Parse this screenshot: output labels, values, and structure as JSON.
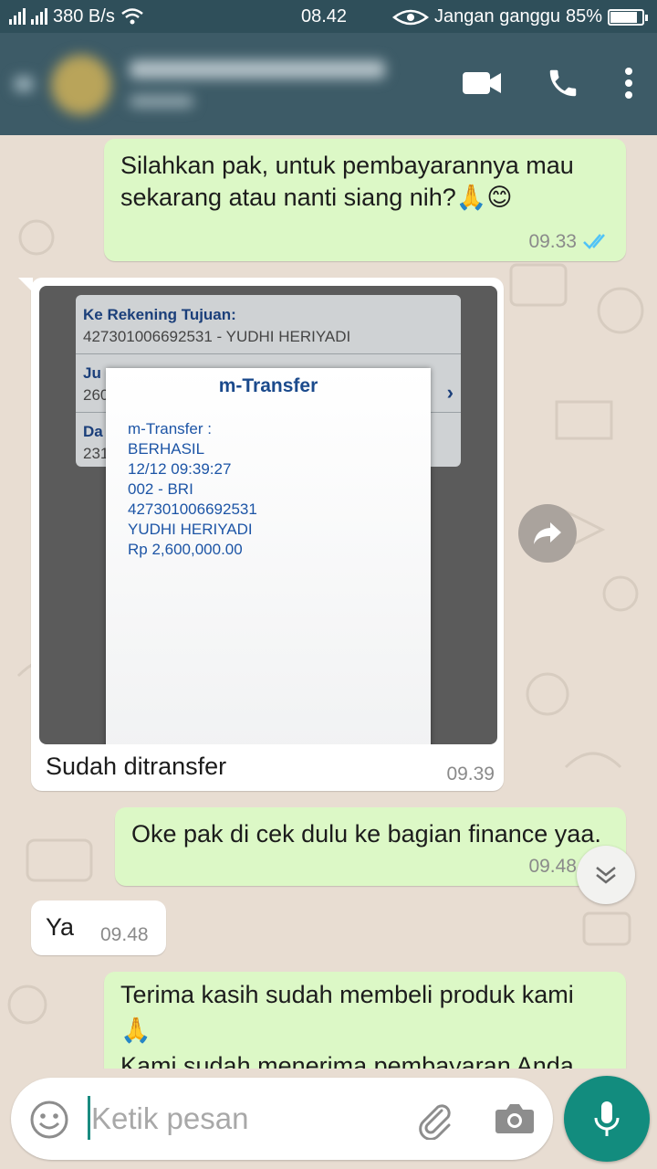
{
  "status_bar": {
    "speed": "380 B/s",
    "time": "08.42",
    "mode": "Jangan ganggu",
    "battery": "85%",
    "battery_level": 0.85
  },
  "app_bar": {
    "icons": [
      "video-call-icon",
      "phone-call-icon",
      "more-options-icon"
    ]
  },
  "messages": [
    {
      "direction": "out",
      "lines": [
        "Silahkan pak, untuk pembayarannya mau",
        "sekarang atau nanti siang nih?🙏😊"
      ],
      "time": "09.33",
      "status": "read"
    },
    {
      "direction": "in",
      "type": "image",
      "caption": "Sudah ditransfer",
      "time": "09.39",
      "image": {
        "bg_label_1": "Ke Rekening Tujuan:",
        "bg_value_1": "427301006692531 - YUDHI HERIYADI",
        "bg_label_2": "Ju",
        "bg_value_2": "260",
        "bg_label_3": "Da",
        "bg_value_3": "231",
        "card_title": "m-Transfer",
        "card_lines": [
          "m-Transfer :",
          "BERHASIL",
          "12/12 09:39:27",
          "002 - BRI",
          "427301006692531",
          "YUDHI HERIYADI",
          "Rp 2,600,000.00"
        ]
      }
    },
    {
      "direction": "out",
      "lines": [
        "Oke pak di cek dulu ke bagian finance yaa."
      ],
      "time": "09.48",
      "status": "read"
    },
    {
      "direction": "in",
      "lines": [
        "Ya"
      ],
      "time": "09.48"
    },
    {
      "direction": "out",
      "lines": [
        "Terima kasih sudah membeli produk kami",
        "🙏",
        "Kami sudah menerima pembayaran Anda"
      ]
    }
  ],
  "composer": {
    "placeholder": "Ketik pesan"
  },
  "colors": {
    "header": "#3d5b67",
    "outgoing_bubble": "#dcf8c6",
    "incoming_bubble": "#ffffff",
    "wallpaper": "#e8ddd2",
    "accent": "#128c7e",
    "read_ticks": "#4fc3f7"
  }
}
